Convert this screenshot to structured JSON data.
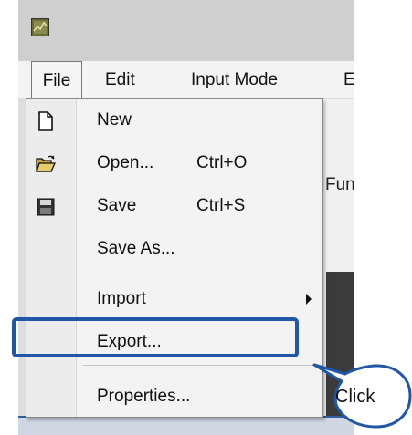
{
  "menubar": {
    "file": "File",
    "edit": "Edit",
    "input_mode": "Input Mode",
    "next": "E"
  },
  "background": {
    "partial_label": "Fun"
  },
  "file_menu": {
    "items": [
      {
        "label": "New",
        "icon": "new-document-icon"
      },
      {
        "label": "Open...",
        "shortcut": "Ctrl+O",
        "icon": "open-folder-icon"
      },
      {
        "label": "Save",
        "shortcut": "Ctrl+S",
        "icon": "floppy-disk-icon"
      },
      {
        "label": "Save As..."
      },
      {
        "label": "Import",
        "submenu": true
      },
      {
        "label": "Export..."
      },
      {
        "label": "Properties..."
      }
    ]
  },
  "annotation": {
    "callout_text": "Click",
    "accent_color": "#1f56a6"
  }
}
